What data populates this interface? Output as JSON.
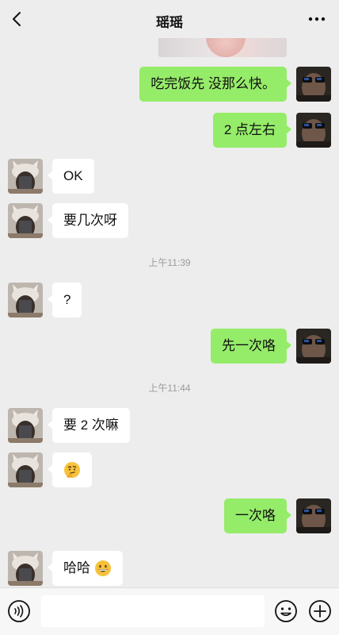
{
  "header": {
    "title": "瑶瑶",
    "back_icon": "chevron-left-icon",
    "more_icon": "more-dots-icon"
  },
  "messages": [
    {
      "side": "out",
      "text": "吃完饭先 没那么快。"
    },
    {
      "side": "out",
      "text": "2 点左右"
    },
    {
      "side": "in",
      "text": "OK"
    },
    {
      "side": "in",
      "text": "要几次呀"
    },
    {
      "type": "timestamp",
      "text": "上午11:39"
    },
    {
      "side": "in",
      "text": "?"
    },
    {
      "side": "out",
      "text": "先一次咯"
    },
    {
      "type": "timestamp",
      "text": "上午11:44"
    },
    {
      "side": "in",
      "text": "要 2 次嘛"
    },
    {
      "side": "in",
      "text": "",
      "emoji": "thinking-face-emoji"
    },
    {
      "side": "out",
      "text": "一次咯"
    },
    {
      "side": "in",
      "text": "哈哈",
      "emoji": "grinning-face-emoji"
    }
  ],
  "input_bar": {
    "voice_icon": "voice-icon",
    "text_value": "",
    "emoji_icon": "smiley-icon",
    "plus_icon": "plus-icon"
  },
  "colors": {
    "background": "#ededed",
    "outgoing_bubble": "#95ec69",
    "incoming_bubble": "#ffffff",
    "timestamp_text": "#9b9b9b"
  }
}
